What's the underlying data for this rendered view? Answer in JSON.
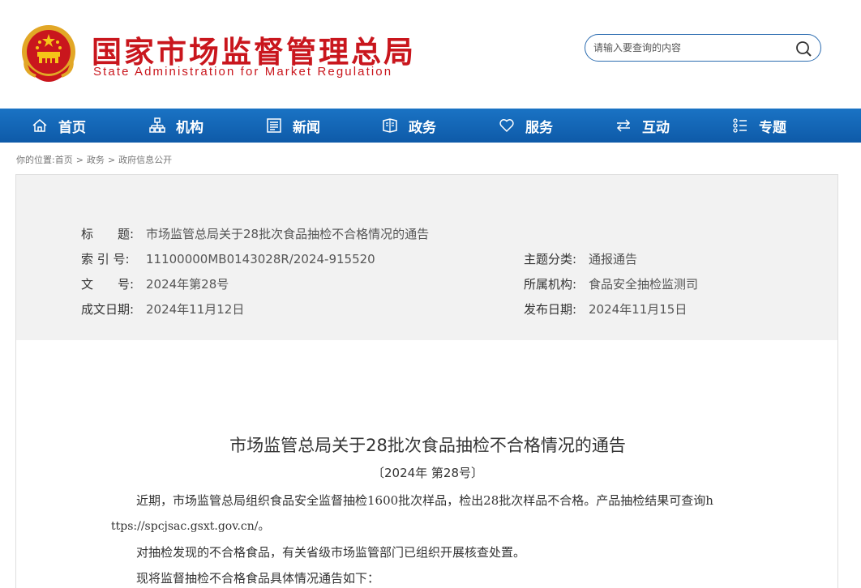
{
  "header": {
    "site_title": "国家市场监督管理总局",
    "site_subtitle": "State Administration for Market Regulation",
    "emblem_icon": "national-emblem-icon",
    "search_placeholder": "请输入要查询的内容",
    "search_icon": "search-icon"
  },
  "nav": {
    "items": [
      {
        "label": "首页",
        "icon": "home-icon"
      },
      {
        "label": "机构",
        "icon": "org-chart-icon"
      },
      {
        "label": "新闻",
        "icon": "news-icon"
      },
      {
        "label": "政务",
        "icon": "government-affairs-icon"
      },
      {
        "label": "服务",
        "icon": "heart-icon"
      },
      {
        "label": "互动",
        "icon": "exchange-arrows-icon"
      },
      {
        "label": "专题",
        "icon": "topic-list-icon"
      }
    ],
    "bg_color": "#1466b8"
  },
  "breadcrumb": {
    "prefix": "你的位置:",
    "items": [
      "首页",
      "政务",
      "政府信息公开"
    ],
    "separator": ">"
  },
  "info": {
    "title_label": "标　　题:",
    "title_value": "市场监管总局关于28批次食品抽检不合格情况的通告",
    "index_label": "索 引 号:",
    "index_value": "11100000MB0143028R/2024-915520",
    "docno_label": "文　　号:",
    "docno_value": "2024年第28号",
    "date_label": "成文日期:",
    "date_value": "2024年11月12日",
    "category_label": "主题分类:",
    "category_value": "通报通告",
    "agency_label": "所属机构:",
    "agency_value": "食品安全抽检监测司",
    "publish_label": "发布日期:",
    "publish_value": "2024年11月15日"
  },
  "document": {
    "title": "市场监管总局关于28批次食品抽检不合格情况的通告",
    "number": "〔2024年 第28号〕",
    "para1_line1": "近期，市场监管总局组织食品安全监督抽检1600批次样品，检出28批次样品不合格。产品抽检结果可查询h",
    "para1_line2": "ttps://spcjsac.gsxt.gov.cn/。",
    "para2": "对抽检发现的不合格食品，有关省级市场监管部门已组织开展核查处置。",
    "para3": "现将监督抽检不合格食品具体情况通告如下："
  },
  "colors": {
    "brand_red": "#c9161d",
    "nav_blue": "#1466b8",
    "panel_gray": "#f2f2f2"
  }
}
